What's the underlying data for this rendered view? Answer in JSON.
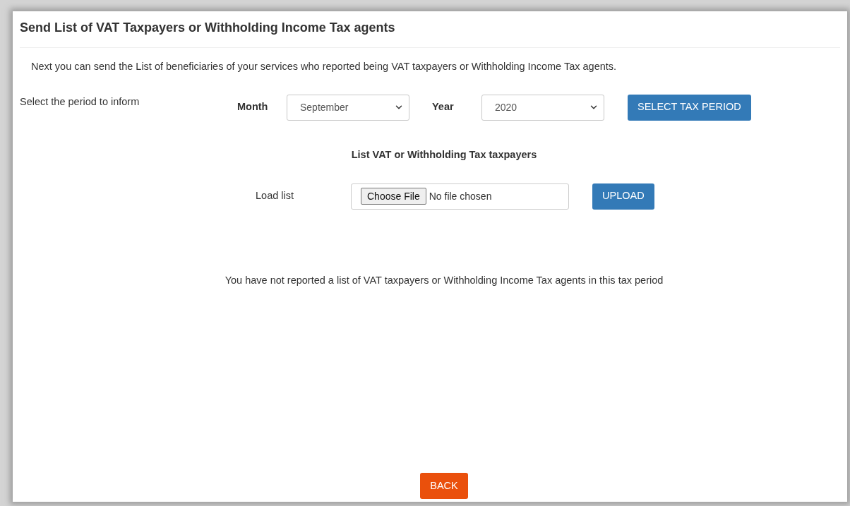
{
  "title": "Send List of VAT Taxpayers or Withholding Income Tax agents",
  "intro": "Next you can send the List of beneficiaries of your services who reported being VAT taxpayers or Withholding Income Tax agents.",
  "period": {
    "label": "Select the period to inform",
    "month_label": "Month",
    "month_value": "September",
    "year_label": "Year",
    "year_value": "2020",
    "button": "SELECT TAX PERIOD"
  },
  "list_heading": "List VAT or Withholding Tax taxpayers",
  "upload": {
    "label": "Load list",
    "choose_button": "Choose File",
    "file_status": "No file chosen",
    "button": "UPLOAD"
  },
  "message": "You have not reported a list of VAT taxpayers or Withholding Income Tax agents in this tax period",
  "back_button": "BACK"
}
